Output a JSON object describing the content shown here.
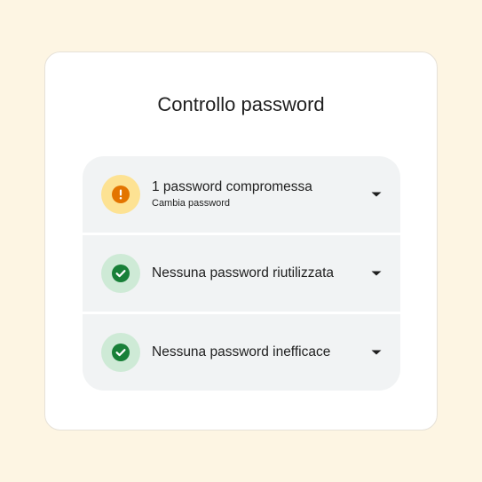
{
  "card": {
    "title": "Controllo password"
  },
  "checks": [
    {
      "status": "warning",
      "icon": "exclamation-icon",
      "title": "1 password compromessa",
      "subtitle": "Cambia password"
    },
    {
      "status": "ok",
      "icon": "check-icon",
      "title": "Nessuna password riutilizzata"
    },
    {
      "status": "ok",
      "icon": "check-icon",
      "title": "Nessuna password inefficace"
    }
  ],
  "colors": {
    "background": "#fdf5e3",
    "card": "#ffffff",
    "row": "#f1f3f4",
    "warning_badge": "#fde293",
    "warning_icon": "#e37400",
    "ok_badge": "#ceead6",
    "ok_icon": "#188038"
  }
}
